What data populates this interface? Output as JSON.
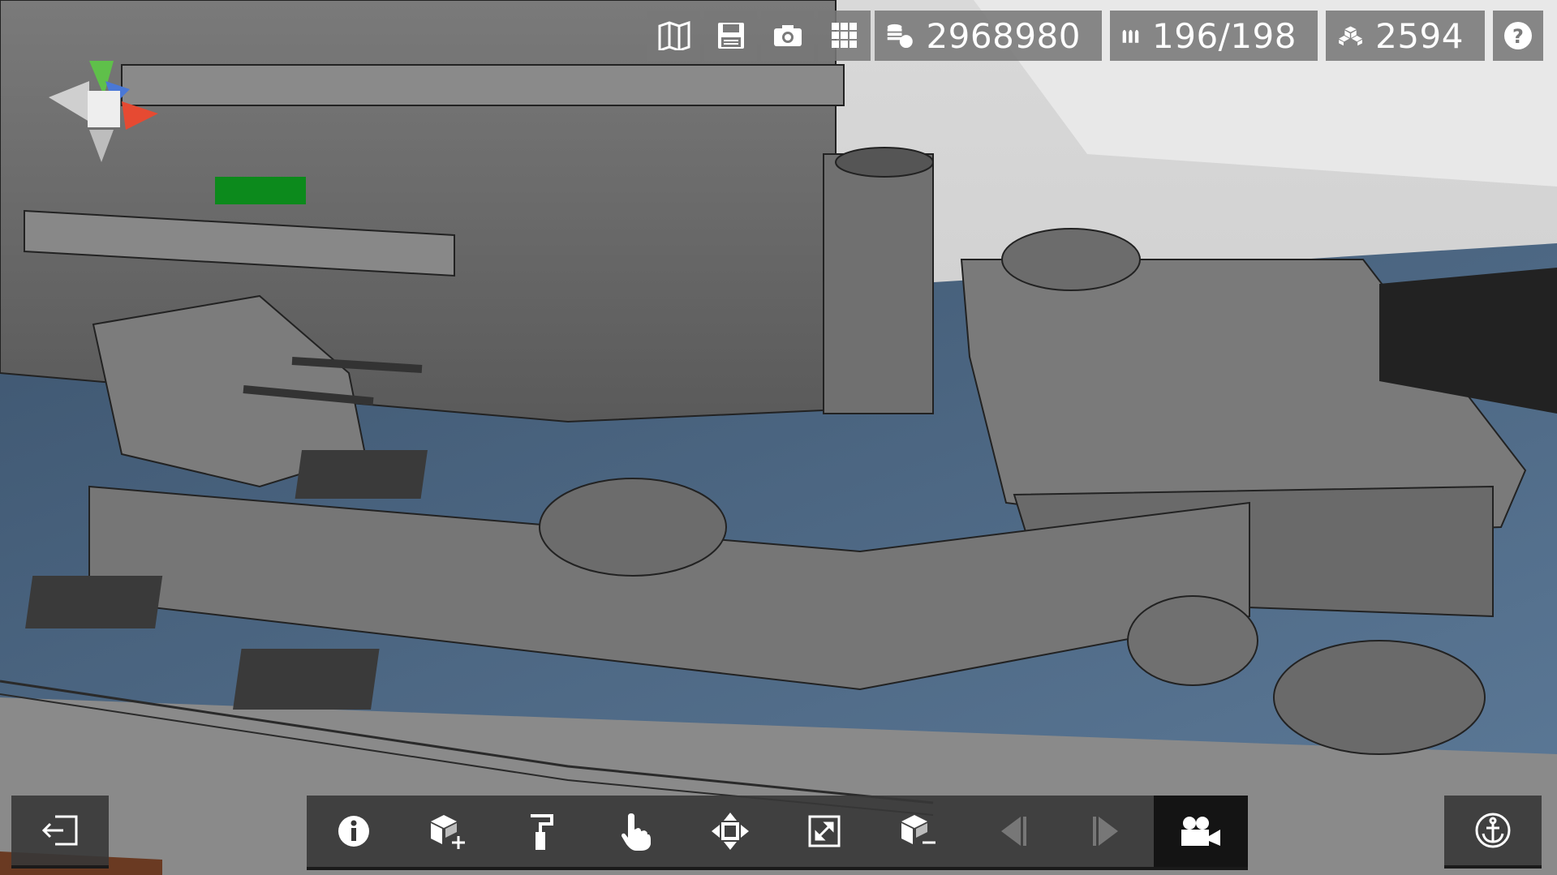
{
  "hud": {
    "coins": "2968980",
    "ammo": "196/198",
    "parts": "2594"
  },
  "icons": {
    "map": "map-icon",
    "save": "save-icon",
    "screenshot": "camera-icon",
    "grid": "grid-icon",
    "coins": "coins-icon",
    "ammo": "ammo-icon",
    "parts": "cubes-icon",
    "help": "help-icon",
    "exit": "exit-icon",
    "info": "info-icon",
    "add_part": "add-block-icon",
    "paint": "paint-roller-icon",
    "select": "hand-pointer-icon",
    "move": "move-arrows-icon",
    "resize": "resize-icon",
    "remove_part": "remove-block-icon",
    "prev": "previous-icon",
    "next": "next-icon",
    "camera": "video-camera-icon",
    "anchor": "anchor-icon"
  },
  "colors": {
    "hud_bg": "#787878",
    "toolbar_bg": "#373737",
    "active_bg": "#141414",
    "deck_blue": "#4a6580",
    "hull_grey": "#6e6e6e",
    "highlight_green": "#0c8a1c"
  }
}
